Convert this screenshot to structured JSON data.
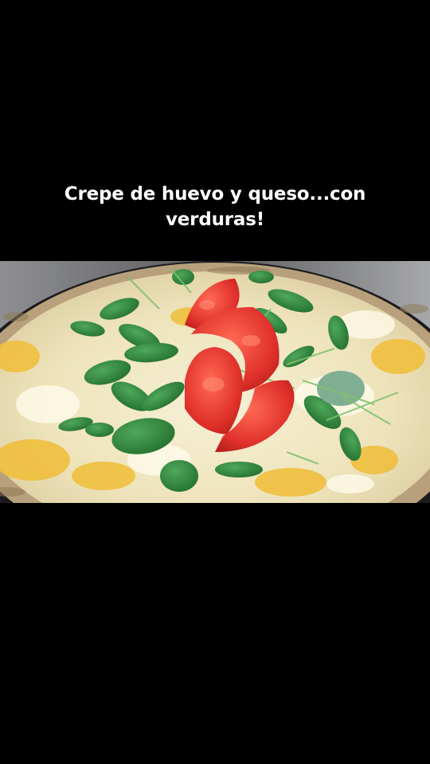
{
  "caption": {
    "text": "Crepe de huevo y queso...con verduras!",
    "color": "#ffffff"
  },
  "photo": {
    "subject": "crepe with melted cheese, egg, cherry tomatoes slices and lamb's lettuce",
    "colors": {
      "background": "#000000",
      "counter": "#6d6e70",
      "pan": "#1d1d1f",
      "crepe": "#b8a27e",
      "cheese": "#f0e8c2",
      "egg": "#f2c24a",
      "tomato": "#e4352a",
      "greens": "#2f8a3c"
    }
  }
}
